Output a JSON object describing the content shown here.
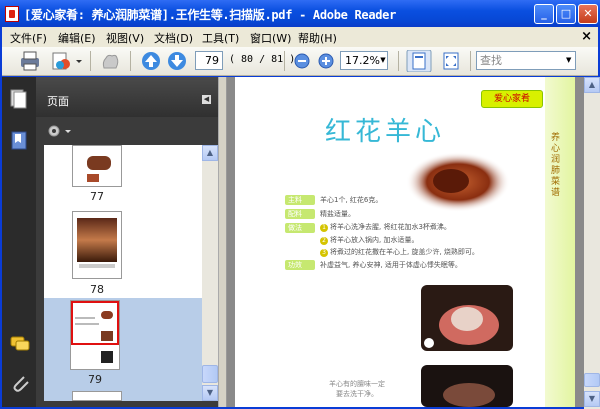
{
  "window": {
    "title": "[爱心家肴: 养心润肺菜谱].王作生等.扫描版.pdf - Adobe Reader",
    "min_glyph": "_",
    "max_glyph": "□",
    "close_glyph": "✕"
  },
  "menu": [
    "文件(F)",
    "编辑(E)",
    "视图(V)",
    "文档(D)",
    "工具(T)",
    "窗口(W)",
    "帮助(H)"
  ],
  "menu_close_glyph": "×",
  "toolbar": {
    "page_value": "79",
    "page_count": "( 80 / 81 )",
    "zoom_value": "17.2%",
    "search_placeholder": "查找"
  },
  "panel": {
    "title": "页面",
    "thumbnails": [
      {
        "label": "77"
      },
      {
        "label": "78"
      },
      {
        "label": "79",
        "selected": true
      }
    ]
  },
  "document": {
    "badge": "爱心家肴",
    "title": "红花羊心",
    "side_text": "养心润肺菜谱",
    "sections": [
      {
        "label": "主料",
        "text": "羊心1个, 红花6克。"
      },
      {
        "label": "配料",
        "text": "精盐适量。"
      },
      {
        "label": "做法",
        "steps": [
          "将羊心洗净去腥, 将红花加水3杯煮沸。",
          "将羊心放入锅内, 加水适量。",
          "将煮过的红花撒在羊心上, 旋盖少许, 烧熟即可。"
        ]
      },
      {
        "label": "功效",
        "text": "补虚益气, 养心安神, 适用于体虚心悸失眠等。"
      }
    ],
    "caption": "羊心有的膻味一定要去洗干净。"
  },
  "colors": {
    "title_bar": "#0a4fe0",
    "accent_title": "#36b8d6",
    "badge": "#d8f000"
  }
}
